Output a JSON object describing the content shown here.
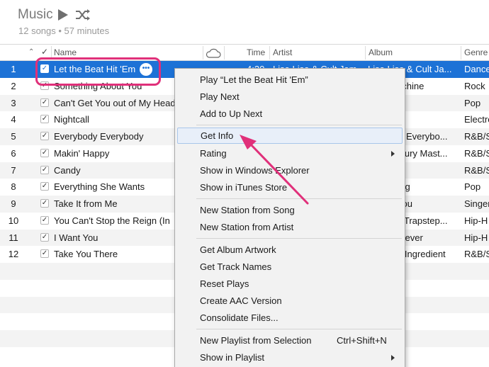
{
  "header": {
    "title": "Music",
    "subtitle": "12 songs • 57 minutes",
    "play_icon": "play-icon",
    "shuffle_icon": "shuffle-icon"
  },
  "columns": {
    "name": "Name",
    "time": "Time",
    "artist": "Artist",
    "album": "Album",
    "genre": "Genre"
  },
  "songs": [
    {
      "num": "1",
      "name": "Let the Beat Hit 'Em",
      "time": "4:20",
      "artist": "Lisa Lisa & Cult Jam",
      "album": "Lisa Lisa & Cult Ja...",
      "genre": "Dance"
    },
    {
      "num": "2",
      "name": "Something About You",
      "time": "",
      "artist": "",
      "album": "achine",
      "genre": "Rock"
    },
    {
      "num": "3",
      "name": "Can't Get You out of My Head",
      "time": "",
      "artist": "",
      "album": "",
      "genre": "Pop"
    },
    {
      "num": "4",
      "name": "Nightcall",
      "time": "",
      "artist": "",
      "album": "",
      "genre": "Electro"
    },
    {
      "num": "5",
      "name": "Everybody Everybody",
      "time": "",
      "artist": "",
      "album": "ly Everybo...",
      "genre": "R&B/S"
    },
    {
      "num": "6",
      "name": "Makin' Happy",
      "time": "",
      "artist": "",
      "album": "ntury Mast...",
      "genre": "R&B/S"
    },
    {
      "num": "7",
      "name": "Candy",
      "time": "",
      "artist": "",
      "album": "!",
      "genre": "R&B/S"
    },
    {
      "num": "8",
      "name": "Everything She Wants",
      "time": "",
      "artist": "",
      "album": "Big",
      "genre": "Pop"
    },
    {
      "num": "9",
      "name": "Take It from Me",
      "time": "",
      "artist": "",
      "album": "You",
      "genre": "Singer"
    },
    {
      "num": "10",
      "name": "You Can't Stop the Reign (In",
      "time": "",
      "artist": "",
      "album": "s Trapstep...",
      "genre": "Hip-H"
    },
    {
      "num": "11",
      "name": "I Want You",
      "time": "",
      "artist": "",
      "album": "orever",
      "genre": "Hip-H"
    },
    {
      "num": "12",
      "name": "Take You There",
      "time": "",
      "artist": "",
      "album": "n Ingredient",
      "genre": "R&B/S"
    }
  ],
  "context_menu": {
    "play": "Play “Let the Beat Hit 'Em”",
    "play_next": "Play Next",
    "add_up_next": "Add to Up Next",
    "get_info": "Get Info",
    "rating": "Rating",
    "show_explorer": "Show in Windows Explorer",
    "show_store": "Show in iTunes Store",
    "station_song": "New Station from Song",
    "station_artist": "New Station from Artist",
    "album_artwork": "Get Album Artwork",
    "track_names": "Get Track Names",
    "reset_plays": "Reset Plays",
    "aac": "Create AAC Version",
    "consolidate": "Consolidate Files...",
    "playlist_selection": "New Playlist from Selection",
    "playlist_shortcut": "Ctrl+Shift+N",
    "show_playlist": "Show in Playlist"
  },
  "colors": {
    "selection": "#1d72d6",
    "annotation": "#e0307a"
  }
}
